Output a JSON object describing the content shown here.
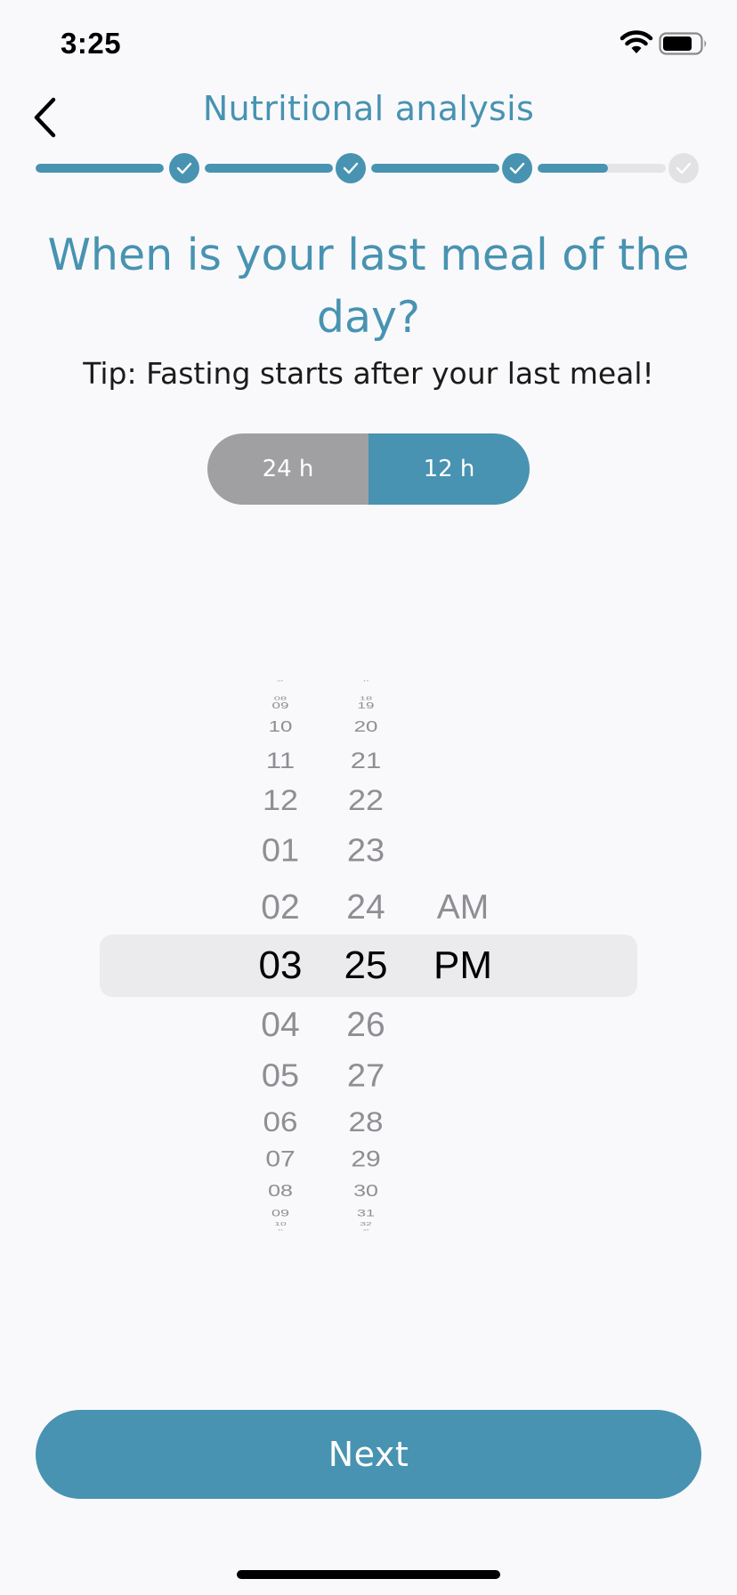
{
  "status_bar": {
    "time": "3:25"
  },
  "header": {
    "title": "Nutritional analysis"
  },
  "progress": {
    "completed_steps": 3,
    "total_steps": 4,
    "current_step_fill": 0.55
  },
  "question": {
    "title": "When is your last meal of the day?",
    "tip": "Tip: Fasting starts after your last meal!"
  },
  "time_format": {
    "options": [
      "24 h",
      "12 h"
    ],
    "selected": "12 h"
  },
  "picker": {
    "hours": [
      "07",
      "08",
      "09",
      "10",
      "11",
      "12",
      "01",
      "02",
      "03",
      "04",
      "05",
      "06",
      "07",
      "08",
      "09",
      "10",
      "11"
    ],
    "minutes": [
      "17",
      "18",
      "19",
      "20",
      "21",
      "22",
      "23",
      "24",
      "25",
      "26",
      "27",
      "28",
      "29",
      "30",
      "31",
      "32",
      "33"
    ],
    "periods": [
      "AM",
      "PM"
    ],
    "selected": {
      "hour": "03",
      "minute": "25",
      "period": "PM"
    }
  },
  "actions": {
    "next_label": "Next"
  },
  "colors": {
    "accent": "#4893b1",
    "toggle_inactive": "#a0a0a2",
    "picker_text": "#8e8e93"
  }
}
